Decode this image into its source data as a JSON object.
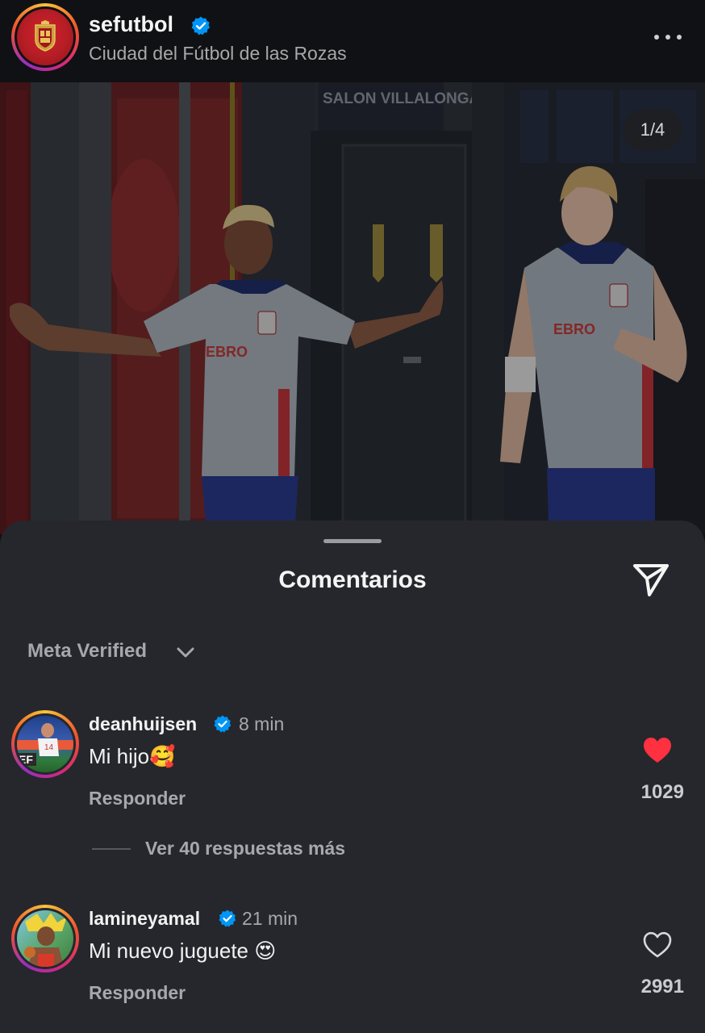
{
  "header": {
    "account_name": "sefutbol",
    "location": "Ciudad del Fútbol de las Rozas",
    "more_icon": "more-horizontal-icon",
    "verified_icon": "verified-badge-icon"
  },
  "photo": {
    "counter": "1/4",
    "door_sign": "SALON VILLALONGA",
    "shirt_text_left": "EBRO",
    "shirt_text_right": "EBRO"
  },
  "comments_sheet": {
    "title": "Comentarios",
    "share_icon": "send-icon",
    "filter_label": "Meta Verified",
    "filter_icon": "chevron-down-icon",
    "comments": [
      {
        "username": "deanhuijsen",
        "time": "8 min",
        "text": "Mi hijo🥰",
        "reply_label": "Responder",
        "likes": "1029",
        "liked": true,
        "heart_color": "#ff3040"
      },
      {
        "username": "lamineyamal",
        "time": "21 min",
        "text": "Mi nuevo juguete 😍",
        "reply_label": "Responder",
        "likes": "2991",
        "liked": false
      }
    ],
    "more_replies": "Ver 40 respuestas más"
  },
  "colors": {
    "sheet_bg": "#25272c",
    "verified_blue": "#0095f6",
    "secondary_text": "#a6a8ab"
  }
}
